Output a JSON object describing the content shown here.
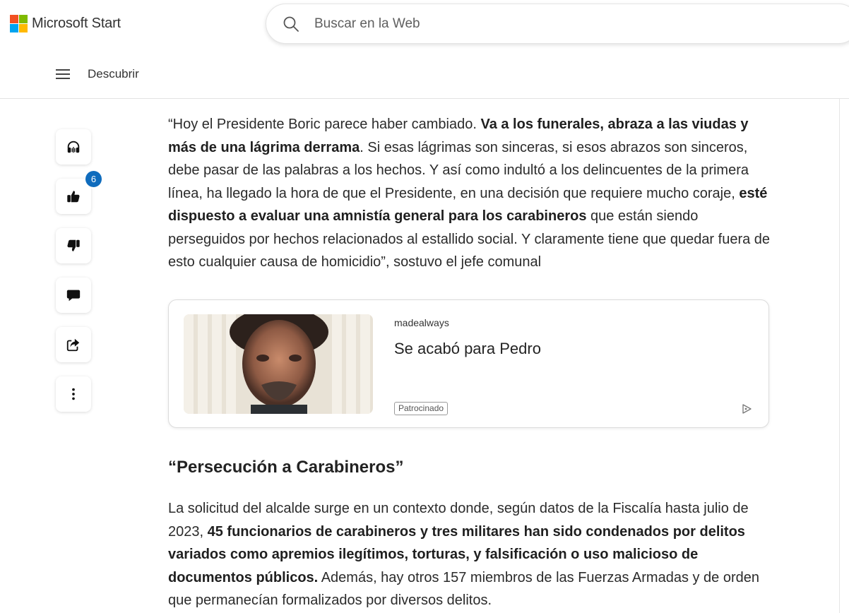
{
  "header": {
    "brand_name": "Microsoft Start",
    "logo_colors": [
      "#f25022",
      "#7fba00",
      "#00a4ef",
      "#ffb900"
    ],
    "search_placeholder": "Buscar en la Web",
    "search_icon": "search-icon"
  },
  "subnav": {
    "menu_icon": "hamburger-icon",
    "label": "Descubrir"
  },
  "rail": {
    "listen_icon": "headphones-icon",
    "like_icon": "thumbs-up-icon",
    "like_count": "6",
    "dislike_icon": "thumbs-down-icon",
    "comment_icon": "comment-icon",
    "share_icon": "share-icon",
    "more_icon": "more-vertical-icon",
    "badge_color": "#0f6cbd"
  },
  "article": {
    "para1": {
      "t1": "“Hoy el Presidente Boric parece haber cambiado. ",
      "b1": "Va a los funerales, abraza a las viudas y más de una lágrima derrama",
      "t2": ". Si esas lágrimas son sinceras, si esos abrazos son sinceros, debe pasar de las palabras a los hechos. Y así como indultó a los delincuentes de la primera línea, ha llegado la hora de que el Presidente, en una decisión que requiere mucho coraje, ",
      "b2": "esté dispuesto a evaluar una amnistía general para los carabineros",
      "t3": " que están siendo perseguidos por hechos relacionados al estallido social. Y claramente tiene que quedar fuera de esto cualquier causa de homicidio”, sostuvo el jefe comunal"
    },
    "ad": {
      "source": "madealways",
      "title": "Se acabó para Pedro",
      "tag": "Patrocinado",
      "ad_icon": "ad-choices-icon"
    },
    "section_heading": "“Persecución a Carabineros”",
    "para2": {
      "t1": "La solicitud del alcalde surge en un contexto donde, según datos de la Fiscalía hasta julio de 2023, ",
      "b1": "45 funcionarios de carabineros y tres militares han sido condenados por delitos variados como apremios ilegítimos, torturas, y falsificación o uso malicioso de documentos públicos.",
      "t2": " Además, hay otros 157 miembros de las Fuerzas Armadas y de orden que permanecían formalizados por diversos delitos."
    }
  }
}
